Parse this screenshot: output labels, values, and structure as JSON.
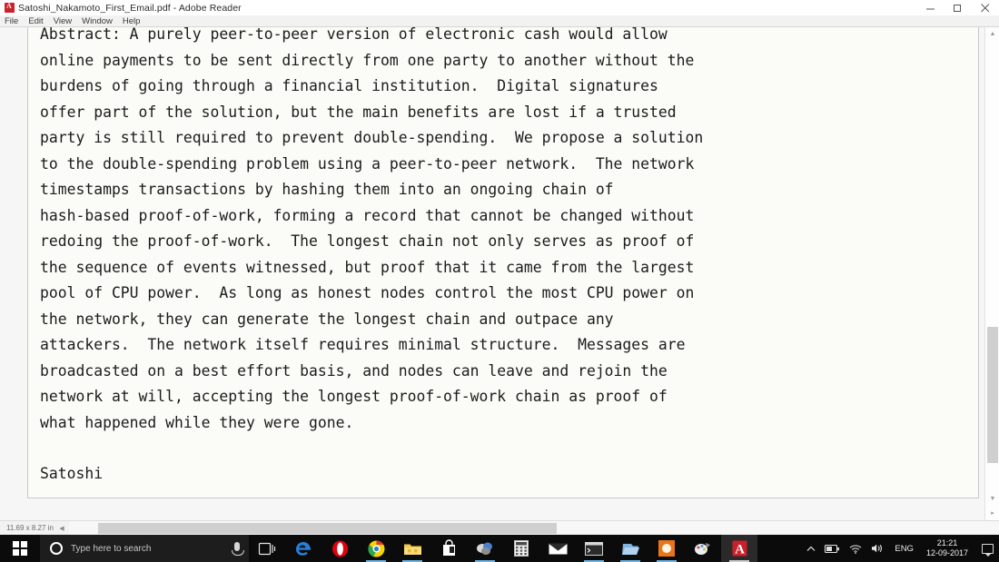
{
  "window": {
    "title": "Satoshi_Nakamoto_First_Email.pdf - Adobe Reader",
    "app_icon": "adobe-reader-icon",
    "controls": {
      "minimize": "minimize-icon",
      "maximize": "restore-icon",
      "close": "close-icon"
    }
  },
  "menubar": {
    "items": [
      {
        "label": "File"
      },
      {
        "label": "Edit"
      },
      {
        "label": "View"
      },
      {
        "label": "Window"
      },
      {
        "label": "Help"
      }
    ]
  },
  "document": {
    "body": "Abstract: A purely peer-to-peer version of electronic cash would allow\nonline payments to be sent directly from one party to another without the\nburdens of going through a financial institution.  Digital signatures\noffer part of the solution, but the main benefits are lost if a trusted\nparty is still required to prevent double-spending.  We propose a solution\nto the double-spending problem using a peer-to-peer network.  The network\ntimestamps transactions by hashing them into an ongoing chain of\nhash-based proof-of-work, forming a record that cannot be changed without\nredoing the proof-of-work.  The longest chain not only serves as proof of\nthe sequence of events witnessed, but proof that it came from the largest\npool of CPU power.  As long as honest nodes control the most CPU power on\nthe network, they can generate the longest chain and outpace any\nattackers.  The network itself requires minimal structure.  Messages are\nbroadcasted on a best effort basis, and nodes can leave and rejoin the\nnetwork at will, accepting the longest proof-of-work chain as proof of\nwhat happened while they were gone.",
    "signature": "Satoshi"
  },
  "statusbar": {
    "page_size": "11.69 x 8.27 in",
    "collapse_icon": "chevron-left-icon"
  },
  "scrollbars": {
    "vertical": {
      "up_arrow": "chevron-up-icon",
      "down_arrow": "chevron-down-icon",
      "corner": "resize-grip-icon"
    },
    "horizontal": {
      "left_arrow": "chevron-left-icon"
    }
  },
  "taskbar": {
    "start": {
      "name": "start-button",
      "icon": "windows-logo-icon"
    },
    "search": {
      "placeholder": "Type here to search",
      "cortana_icon": "cortana-circle-icon",
      "mic_icon": "microphone-icon"
    },
    "apps": [
      {
        "name": "task-view-button",
        "icon": "task-view-icon",
        "running": false,
        "active": false
      },
      {
        "name": "microsoft-edge",
        "icon": "edge-icon",
        "running": false,
        "active": false
      },
      {
        "name": "opera-browser",
        "icon": "opera-icon",
        "running": false,
        "active": false
      },
      {
        "name": "google-chrome",
        "icon": "chrome-icon",
        "running": true,
        "active": false
      },
      {
        "name": "file-explorer",
        "icon": "folder-icon",
        "running": true,
        "active": false
      },
      {
        "name": "microsoft-store",
        "icon": "store-icon",
        "running": false,
        "active": false
      },
      {
        "name": "photo-editor",
        "icon": "photos-icon",
        "running": true,
        "active": false
      },
      {
        "name": "calculator",
        "icon": "calculator-icon",
        "running": false,
        "active": false
      },
      {
        "name": "mail-app",
        "icon": "envelope-icon",
        "running": false,
        "active": false
      },
      {
        "name": "command-prompt",
        "icon": "terminal-icon",
        "running": true,
        "active": false
      },
      {
        "name": "file-manager",
        "icon": "blue-folder-icon",
        "running": true,
        "active": false
      },
      {
        "name": "media-player",
        "icon": "orange-circle-icon",
        "running": true,
        "active": false
      },
      {
        "name": "paint-app",
        "icon": "palette-icon",
        "running": false,
        "active": false
      },
      {
        "name": "adobe-reader",
        "icon": "adobe-reader-icon",
        "running": true,
        "active": true
      }
    ],
    "tray": {
      "show_hidden": "chevron-up-icon",
      "battery": "battery-icon",
      "network": "wifi-icon",
      "volume": "speaker-icon",
      "language": "ENG",
      "time": "21:21",
      "date": "12-09-2017",
      "action_center": "notification-icon"
    }
  },
  "colors": {
    "page_bg": "#fbfbf7",
    "viewer_bg": "#f6f6f6",
    "taskbar_bg": "#0b0b0b",
    "accent": "#cc2229",
    "text": "#1b1b1b"
  }
}
